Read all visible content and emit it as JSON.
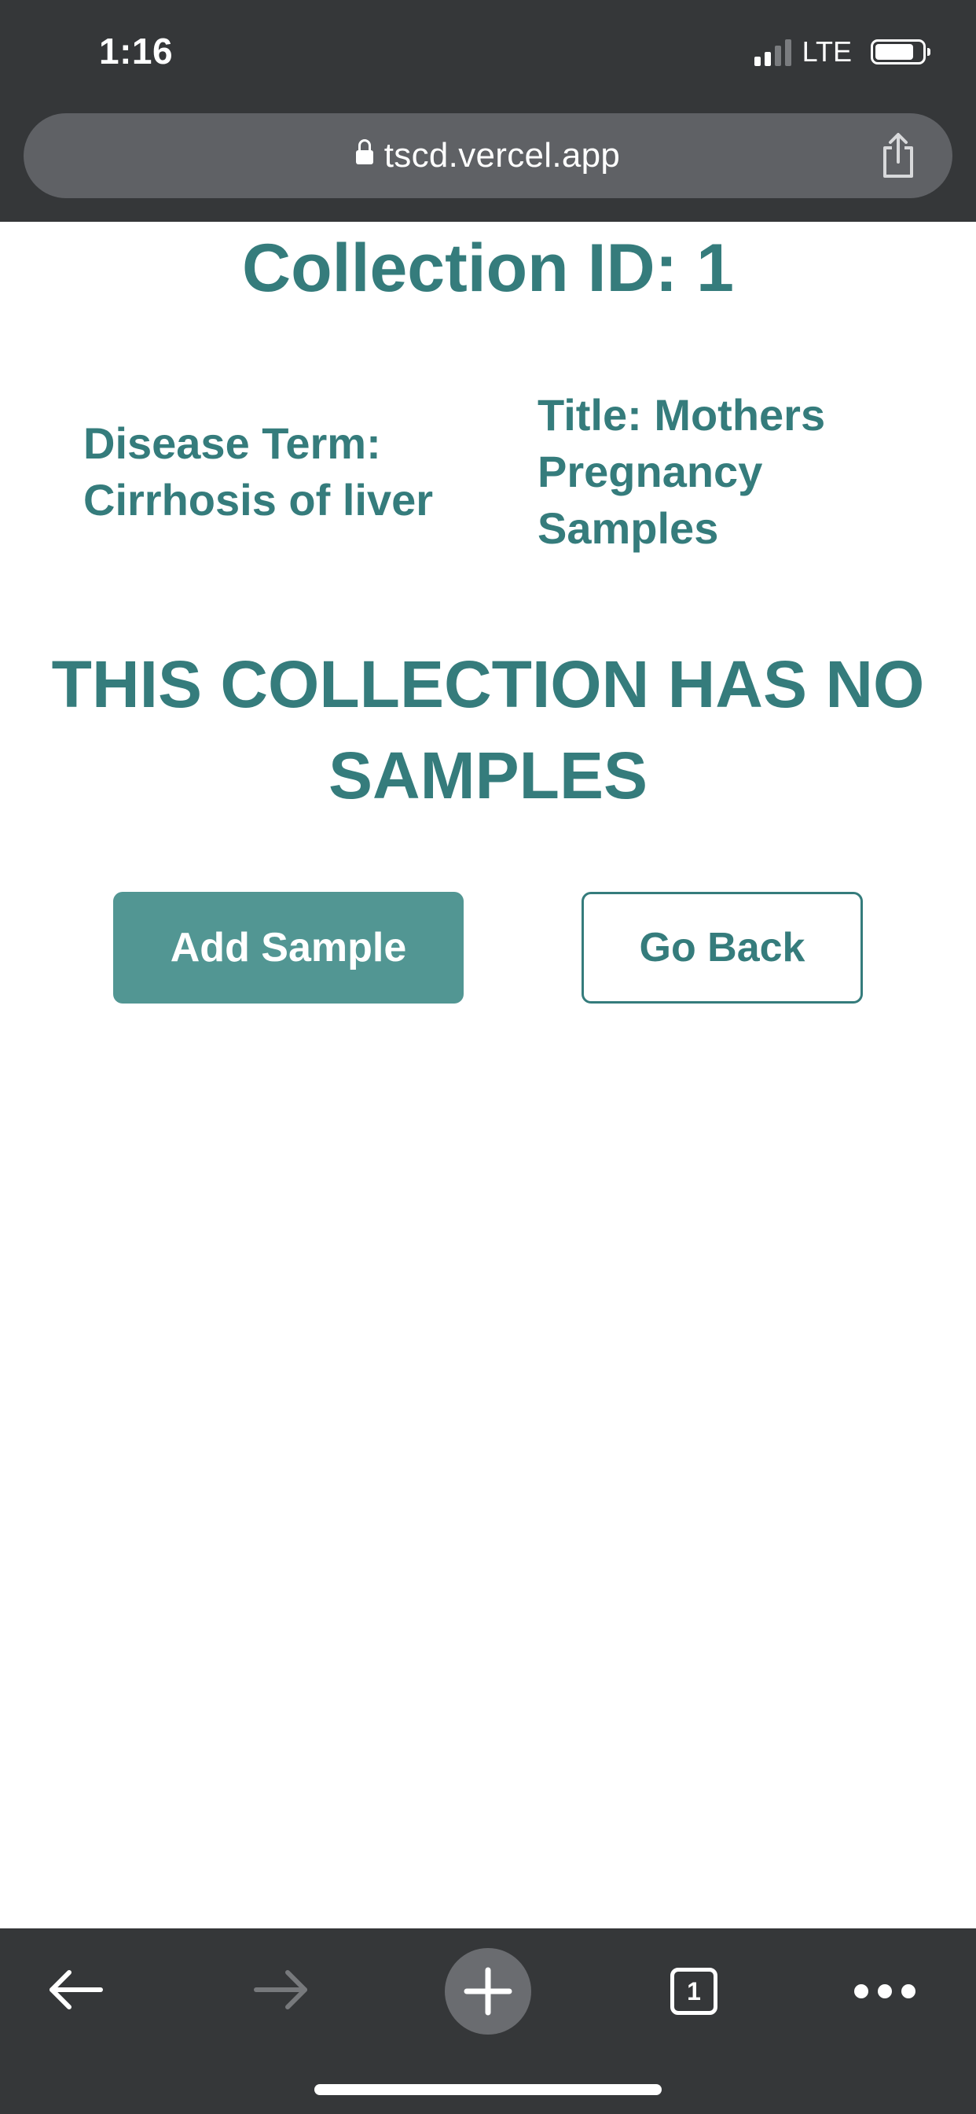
{
  "status_bar": {
    "time": "1:16",
    "network": "LTE",
    "signal_bars": 2,
    "signal_bars_total": 4
  },
  "browser": {
    "url": "tscd.vercel.app",
    "icons": {
      "lock": "lock-icon",
      "share": "share-icon"
    }
  },
  "page": {
    "title": "Collection ID: 1",
    "disease_term_line1": "Disease Term:",
    "disease_term_line2": "Cirrhosis of liver",
    "title_line1": "Title: Mothers",
    "title_line2": "Pregnancy",
    "title_line3": "Samples",
    "empty_message_line1": "THIS COLLECTION HAS NO",
    "empty_message_line2": "SAMPLES",
    "add_sample_label": "Add Sample",
    "go_back_label": "Go Back"
  },
  "toolbar": {
    "tab_count": "1",
    "icons": [
      "back-arrow-icon",
      "forward-arrow-icon",
      "new-tab-plus-icon",
      "tabs-icon",
      "more-menu-icon"
    ]
  },
  "colors": {
    "chrome_background": "#353739",
    "url_bar": "#5f6165",
    "accent_text": "#357c7c",
    "add_button_fill": "#529693",
    "page_background": "#ffffff"
  }
}
